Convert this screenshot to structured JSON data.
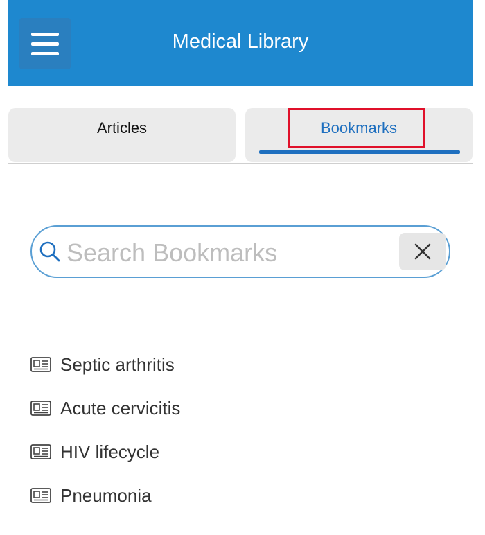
{
  "header": {
    "title": "Medical Library",
    "menu_icon": "hamburger-menu-icon",
    "background_color": "#1e88cf"
  },
  "tabs": [
    {
      "label": "Articles",
      "selected": false
    },
    {
      "label": "Bookmarks",
      "selected": true
    }
  ],
  "search": {
    "placeholder": "Search Bookmarks",
    "value": "",
    "search_icon": "search-icon",
    "clear_icon": "close-icon"
  },
  "bookmarks": [
    {
      "label": "Septic arthritis",
      "icon": "article-icon"
    },
    {
      "label": "Acute cervicitis",
      "icon": "article-icon"
    },
    {
      "label": "HIV lifecycle",
      "icon": "article-icon"
    },
    {
      "label": "Pneumonia",
      "icon": "article-icon"
    }
  ],
  "colors": {
    "accent": "#1e6fbf",
    "highlight_border": "#e0102a"
  }
}
